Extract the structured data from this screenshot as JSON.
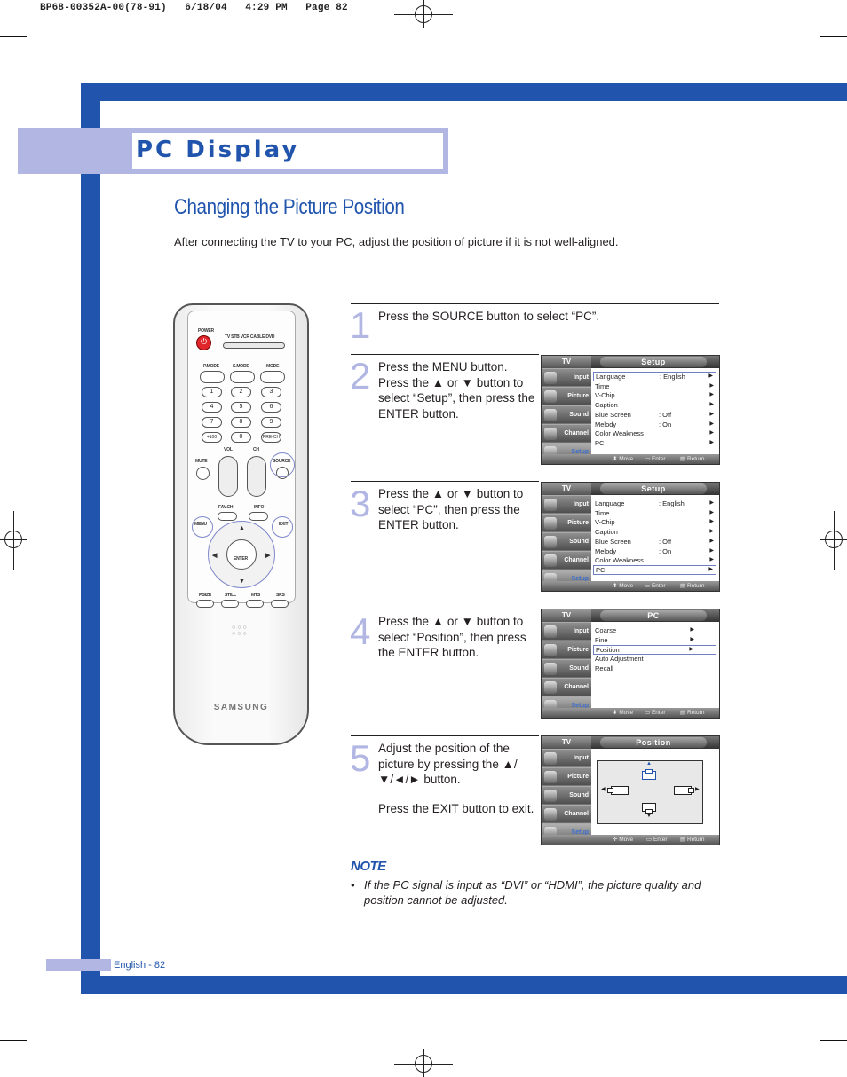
{
  "print_header": "BP68-00352A-00(78-91)   6/18/04   4:29 PM   Page 82",
  "page_title": "PC Display",
  "section_title": "Changing the Picture Position",
  "intro": "After connecting the TV to your PC, adjust the position of picture if it is not well-aligned.",
  "accent_color": "#2155ad",
  "band_color": "#b1b6e3",
  "steps": [
    {
      "num": "1",
      "text": "Press the SOURCE button to select “PC”."
    },
    {
      "num": "2",
      "text": "Press the MENU button.\nPress the ▲ or ▼ button to select “Setup”, then press the ENTER button."
    },
    {
      "num": "3",
      "text": "Press the ▲ or ▼ button to select “PC”, then press the ENTER button."
    },
    {
      "num": "4",
      "text": "Press the ▲ or ▼ button to select “Position”, then press the ENTER button."
    },
    {
      "num": "5",
      "text": "Adjust the position of the picture by pressing the ▲/▼/◄/► button.",
      "text2": "Press the EXIT button to exit."
    }
  ],
  "osd": {
    "tv_label": "TV",
    "tabs": [
      "Input",
      "Picture",
      "Sound",
      "Channel",
      "Setup"
    ],
    "footer": {
      "move": "⬍ Move",
      "move4": "✛ Move",
      "enter": "▭ Enter",
      "return": "▤ Return"
    },
    "setup_title": "Setup",
    "setup_items": [
      {
        "label": "Language",
        "value": ": English"
      },
      {
        "label": "Time",
        "value": ""
      },
      {
        "label": "V-Chip",
        "value": ""
      },
      {
        "label": "Caption",
        "value": ""
      },
      {
        "label": "Blue Screen",
        "value": ": Off"
      },
      {
        "label": "Melody",
        "value": ": On"
      },
      {
        "label": "Color Weakness",
        "value": ""
      },
      {
        "label": "PC",
        "value": ""
      }
    ],
    "pc_title": "PC",
    "pc_items": [
      {
        "label": "Coarse",
        "arrow": true
      },
      {
        "label": "Fine",
        "arrow": true
      },
      {
        "label": "Position",
        "arrow": true
      },
      {
        "label": "Auto Adjustment",
        "arrow": false
      },
      {
        "label": "Recall",
        "arrow": false
      }
    ],
    "position_title": "Position",
    "arrow": "▶"
  },
  "remote": {
    "power": "POWER",
    "power_glyph": "⏻",
    "sources": "TV  STB  VCR  CABLE  DVD",
    "mode_labels": [
      "P.MODE",
      "S.MODE",
      "MODE"
    ],
    "digits": [
      "1",
      "2",
      "3",
      "4",
      "5",
      "6",
      "7",
      "8",
      "9",
      "+100",
      "0",
      "PRE-CH"
    ],
    "vol": "VOL",
    "ch": "CH",
    "mute": "MUTE",
    "source": "SOURCE",
    "fav_ch": "FAV.CH",
    "info": "INFO",
    "menu": "MENU",
    "exit": "EXIT",
    "enter": "ENTER",
    "bottom_labels": [
      "P.SIZE",
      "STILL",
      "MTS",
      "SRS"
    ],
    "brand": "SAMSUNG"
  },
  "note": {
    "heading": "NOTE",
    "bullet": "•",
    "text": "If the PC signal is input as “DVI” or “HDMI”, the picture quality and position cannot be adjusted."
  },
  "footer": "English - 82"
}
